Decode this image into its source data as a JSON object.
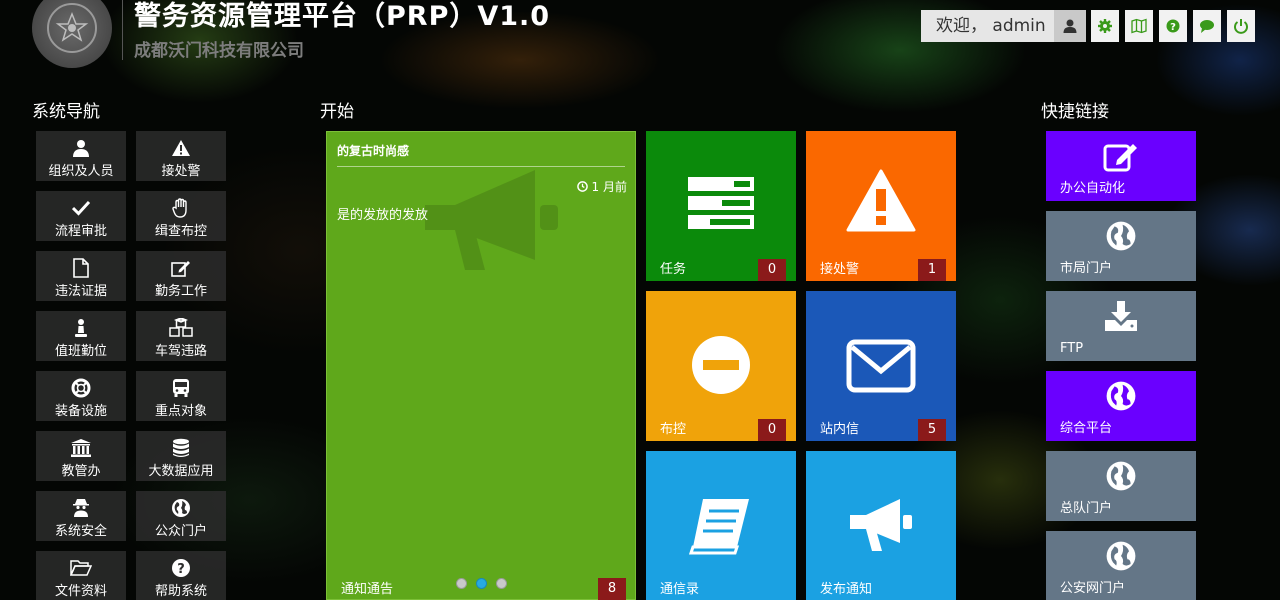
{
  "header": {
    "app_title": "警务资源管理平台（PRP）V1.0",
    "company": "成都沃门科技有限公司",
    "welcome": "欢迎， admin",
    "tool_icons": [
      "settings-icon",
      "map-icon",
      "help-icon",
      "comment-icon",
      "power-icon"
    ]
  },
  "sidebar": {
    "title": "系统导航",
    "items": [
      {
        "label": "组织及人员",
        "icon": "user-icon"
      },
      {
        "label": "接处警",
        "icon": "warning-icon"
      },
      {
        "label": "流程审批",
        "icon": "check-icon"
      },
      {
        "label": "缉查布控",
        "icon": "hand-icon"
      },
      {
        "label": "违法证据",
        "icon": "file-icon"
      },
      {
        "label": "勤务工作",
        "icon": "edit-icon"
      },
      {
        "label": "值班勤位",
        "icon": "chess-pawn-icon"
      },
      {
        "label": "车驾违路",
        "icon": "cubes-icon"
      },
      {
        "label": "装备设施",
        "icon": "lifebuoy-icon"
      },
      {
        "label": "重点对象",
        "icon": "bus-icon"
      },
      {
        "label": "教管办",
        "icon": "bank-icon"
      },
      {
        "label": "大数据应用",
        "icon": "database-icon"
      },
      {
        "label": "系统安全",
        "icon": "user-secret-icon"
      },
      {
        "label": "公众门户",
        "icon": "globe-icon"
      },
      {
        "label": "文件资料",
        "icon": "folder-open-icon"
      },
      {
        "label": "帮助系统",
        "icon": "question-icon"
      }
    ]
  },
  "main": {
    "title": "开始",
    "notice": {
      "title": "的复古时尚感",
      "time": "1 月前",
      "body": "是的发放的发放",
      "label": "通知通告",
      "count": "8",
      "dots": 3,
      "active_dot": 1
    },
    "tiles": [
      {
        "label": "任务",
        "count": "0",
        "color": "#0b8a0b",
        "icon": "tasks-icon"
      },
      {
        "label": "接处警",
        "count": "1",
        "color": "#fa6800",
        "icon": "warning-icon"
      },
      {
        "label": "布控",
        "count": "0",
        "color": "#f0a30a",
        "icon": "minus-circle-icon"
      },
      {
        "label": "站内信",
        "count": "5",
        "color": "#1b58b8",
        "icon": "envelope-icon"
      },
      {
        "label": "通信录",
        "count": "",
        "color": "#1ba1e2",
        "icon": "book-icon"
      },
      {
        "label": "发布通知",
        "count": "",
        "color": "#1ba1e2",
        "icon": "bullhorn-icon"
      }
    ]
  },
  "quick_links": {
    "title": "快捷链接",
    "items": [
      {
        "label": "办公自动化",
        "color": "#6a00ff",
        "icon": "edit-icon"
      },
      {
        "label": "市局门户",
        "color": "#647687",
        "icon": "globe-icon"
      },
      {
        "label": "FTP",
        "color": "#647687",
        "icon": "download-icon"
      },
      {
        "label": "综合平台",
        "color": "#6a00ff",
        "icon": "globe-icon"
      },
      {
        "label": "总队门户",
        "color": "#647687",
        "icon": "globe-icon"
      },
      {
        "label": "公安网门户",
        "color": "#647687",
        "icon": "globe-icon"
      }
    ]
  }
}
